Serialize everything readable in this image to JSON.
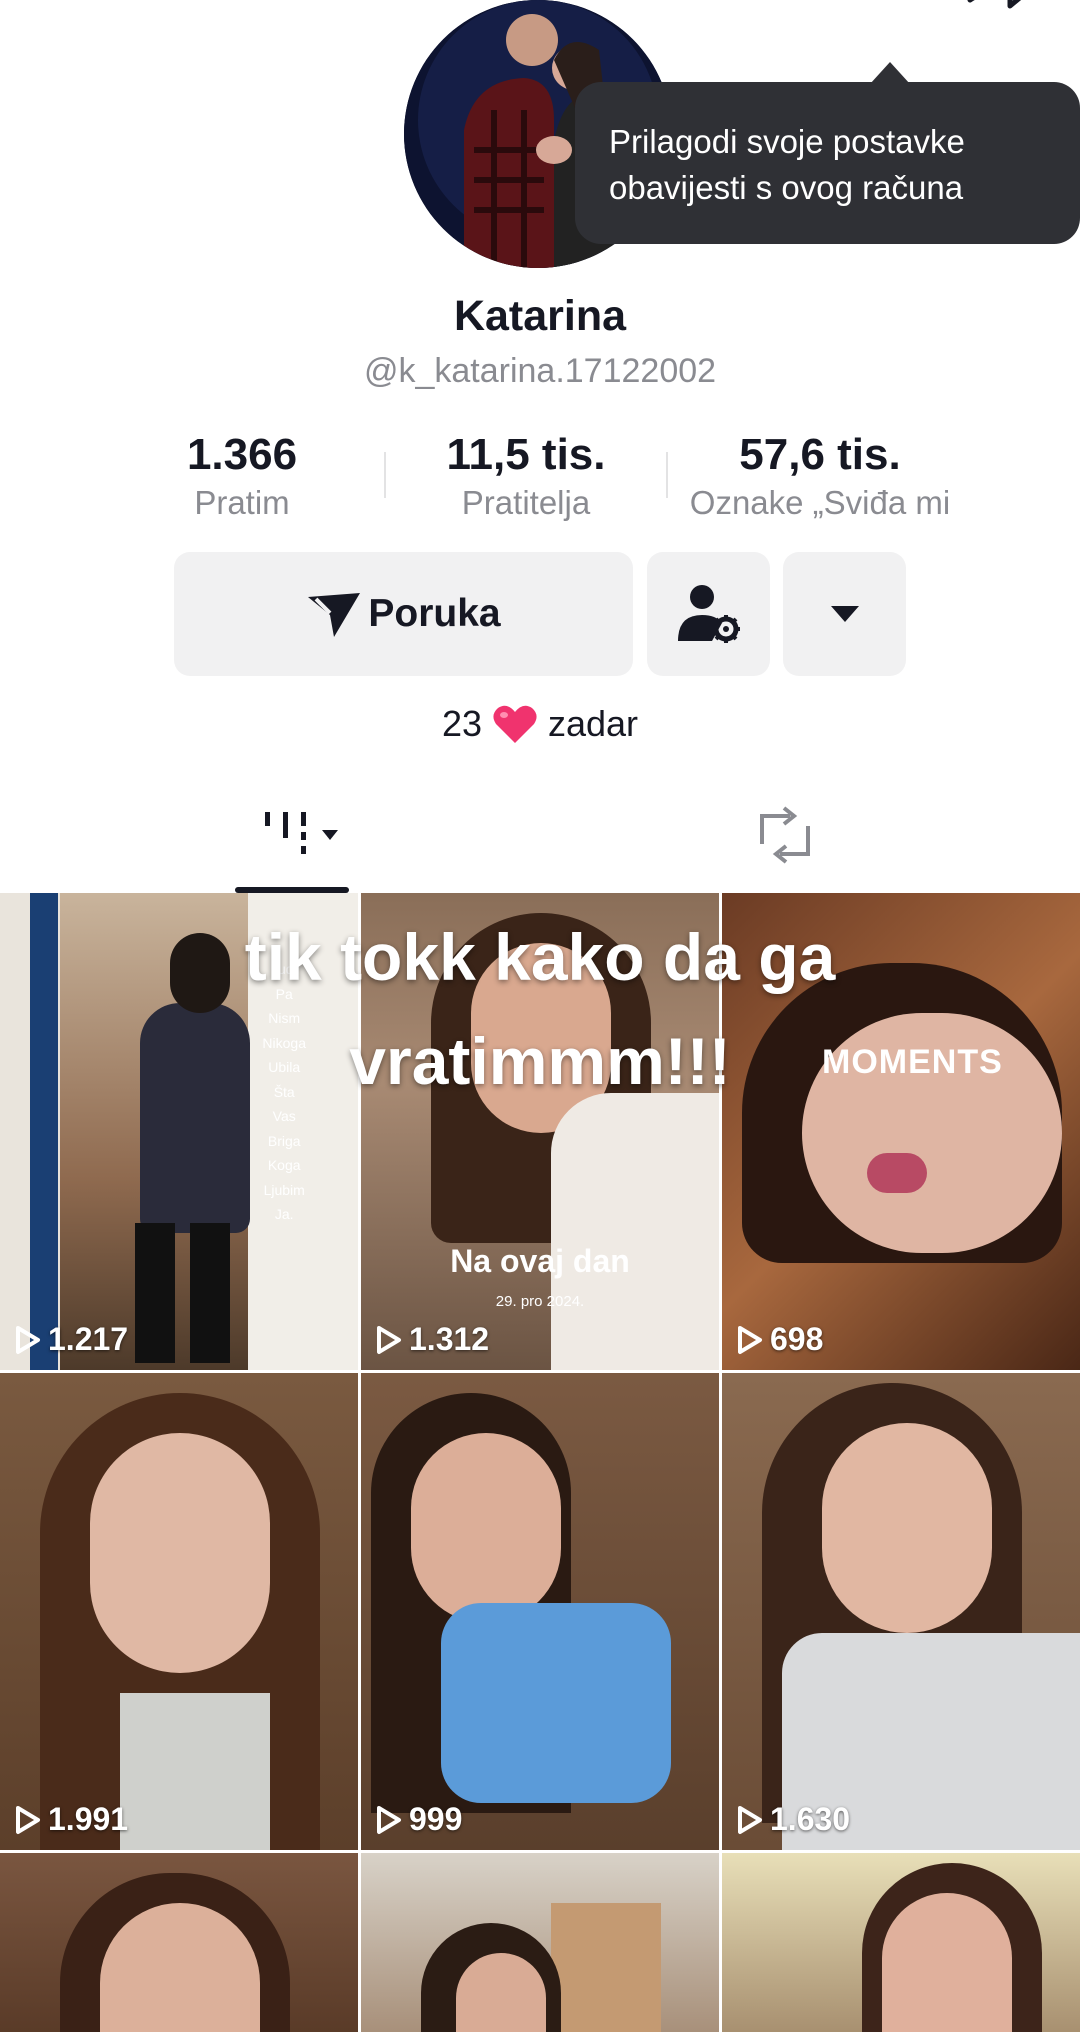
{
  "profile": {
    "name": "Katarina",
    "handle": "@k_katarina.17122002",
    "bio": {
      "prefix": "23",
      "suffix": "zadar"
    }
  },
  "tooltip": {
    "line1": "Prilagodi svoje postavke",
    "line2": "obavijesti s ovog računa"
  },
  "stats": [
    {
      "value": "1.366",
      "label": "Pratim"
    },
    {
      "value": "11,5 tis.",
      "label": "Pratitelja"
    },
    {
      "value": "57,6 tis.",
      "label": "Oznake „Sviđa mi"
    }
  ],
  "buttons": {
    "message": "Poruka"
  },
  "overlay": {
    "line1": "tik tokk  kako da ga",
    "line2": "vratimmm!!!"
  },
  "grid": {
    "tile1_words": [
      "ljudi",
      "Pa",
      "Nism",
      "Nikoga",
      "Ubila",
      "Šta",
      "Vas",
      "Briga",
      "Koga",
      "Ljubim",
      "Ja."
    ],
    "tile2_caption": "Na ovaj dan",
    "tile2_date": "29. pro 2024.",
    "tile3_tag": "MOMENTS",
    "views": [
      "1.217",
      "1.312",
      "698",
      "1.991",
      "999",
      "1.630"
    ]
  },
  "colors": {
    "accent": "#fe2c55",
    "text": "#161823",
    "muted": "#8a8b91",
    "tooltip_bg": "#2f3035"
  }
}
